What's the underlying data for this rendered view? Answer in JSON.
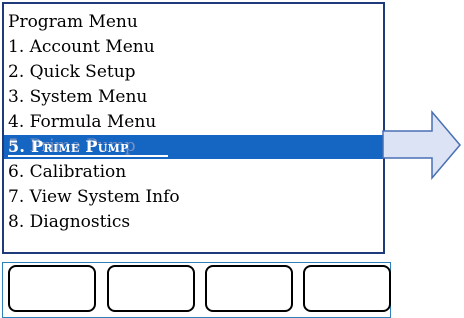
{
  "menu": {
    "title": "Program Menu",
    "items": [
      {
        "label": "1. Account Menu"
      },
      {
        "label": "2. Quick Setup"
      },
      {
        "label": "3. System Menu"
      },
      {
        "label": "4. Formula Menu"
      },
      {
        "label": "5. Prime Pump",
        "selected": true
      },
      {
        "label": "6. Calibration"
      },
      {
        "label": "7. View System Info"
      },
      {
        "label": "8. Diagnostics"
      }
    ],
    "highlight_color": "#1466c2",
    "border_color": "#1f3a7a"
  },
  "arrow": {
    "icon": "right-arrow-icon",
    "fill_color": "#dbe3f4",
    "stroke_color": "#4a6fb3"
  },
  "softkeys": [
    {
      "label": ""
    },
    {
      "label": ""
    },
    {
      "label": ""
    },
    {
      "label": ""
    }
  ]
}
